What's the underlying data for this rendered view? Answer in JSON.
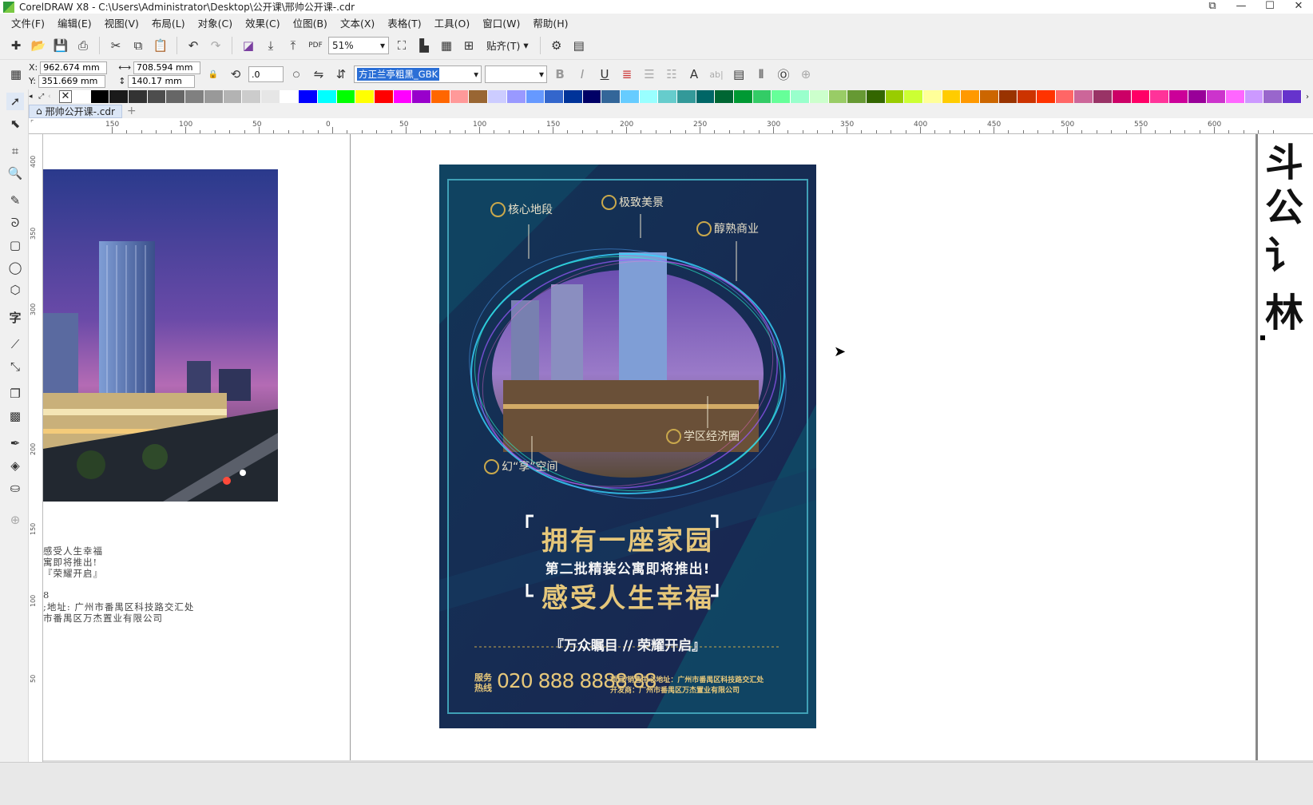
{
  "window": {
    "title": "CorelDRAW X8 - C:\\Users\\Administrator\\Desktop\\公开课\\邢帅公开课-.cdr",
    "controls": [
      "⧉",
      "—",
      "☐",
      "✕"
    ]
  },
  "menu": [
    "文件(F)",
    "编辑(E)",
    "视图(V)",
    "布局(L)",
    "对象(C)",
    "效果(C)",
    "位图(B)",
    "文本(X)",
    "表格(T)",
    "工具(O)",
    "窗口(W)",
    "帮助(H)"
  ],
  "toolbar": {
    "zoom": "51%",
    "snap_label": "贴齐(T)"
  },
  "properties": {
    "x": "962.674 mm",
    "y": "351.669 mm",
    "width": "708.594 mm",
    "height": "140.17 mm",
    "x_label": "X:",
    "y_label": "Y:",
    "rotation": ".0",
    "font": "方正兰亭粗黑_GBK",
    "font_size": ""
  },
  "document_tab": "邢帅公开课-.cdr",
  "ruler_ticks": [
    "150",
    "100",
    "50",
    "0",
    "50",
    "100",
    "150",
    "200",
    "250",
    "300",
    "350",
    "400",
    "450",
    "500",
    "550",
    "600"
  ],
  "vruler_ticks": [
    "400",
    "350",
    "300",
    "200",
    "150",
    "100",
    "50"
  ],
  "side_text": {
    "line1": "感受人生幸福",
    "line2": "寓即将推出!",
    "line3": "『荣耀开启』",
    "line4": "8",
    "line5": ";地址: 广州市番禺区科技路交汇处",
    "line6": "市番禺区万杰置业有限公司"
  },
  "poster": {
    "labels": [
      "核心地段",
      "极致美景",
      "醇熟商业",
      "学区经济圈",
      "幻“享”空间"
    ],
    "headline": "拥有一座家园",
    "subline": "第二批精装公寓即将推出!",
    "headline2": "感受人生幸福",
    "tagline": "『万众瞩目 // 荣耀开启』",
    "service_label1": "服务",
    "service_label2": "热线",
    "phone": "020 888 8888 88",
    "address": "项目/销售中心地址：广州市番禺区科技路交汇处",
    "developer": "开发商：广州市番禺区万杰置业有限公司"
  },
  "right_glyphs": [
    "斗",
    "公",
    "讠",
    "林"
  ],
  "colors": {
    "poster_bg": "#152245",
    "poster_teal": "#0f4a66",
    "gold": "#e6c77a",
    "frame": "#3fa0b6",
    "selection": "#2b6fd6"
  },
  "palette": [
    "#ffffff",
    "#000000",
    "#1a1a1a",
    "#333333",
    "#4d4d4d",
    "#666666",
    "#808080",
    "#999999",
    "#b3b3b3",
    "#cccccc",
    "#e6e6e6",
    "#ffffff",
    "#0000ff",
    "#00ffff",
    "#00ff00",
    "#ffff00",
    "#ff0000",
    "#ff00ff",
    "#9900cc",
    "#ff6600",
    "#ff9999",
    "#996633",
    "#ccccff",
    "#9999ff",
    "#6699ff",
    "#3366cc",
    "#003399",
    "#000066",
    "#336699",
    "#66ccff",
    "#99ffff",
    "#66cccc",
    "#339999",
    "#006666",
    "#006633",
    "#009933",
    "#33cc66",
    "#66ff99",
    "#99ffcc",
    "#ccffcc",
    "#99cc66",
    "#669933",
    "#336600",
    "#99cc00",
    "#ccff33",
    "#ffff99",
    "#ffcc00",
    "#ff9900",
    "#cc6600",
    "#993300",
    "#cc3300",
    "#ff3300",
    "#ff6666",
    "#cc6699",
    "#993366",
    "#cc0066",
    "#ff0066",
    "#ff3399",
    "#cc0099",
    "#990099",
    "#cc33cc",
    "#ff66ff",
    "#cc99ff",
    "#9966cc",
    "#6633cc"
  ]
}
